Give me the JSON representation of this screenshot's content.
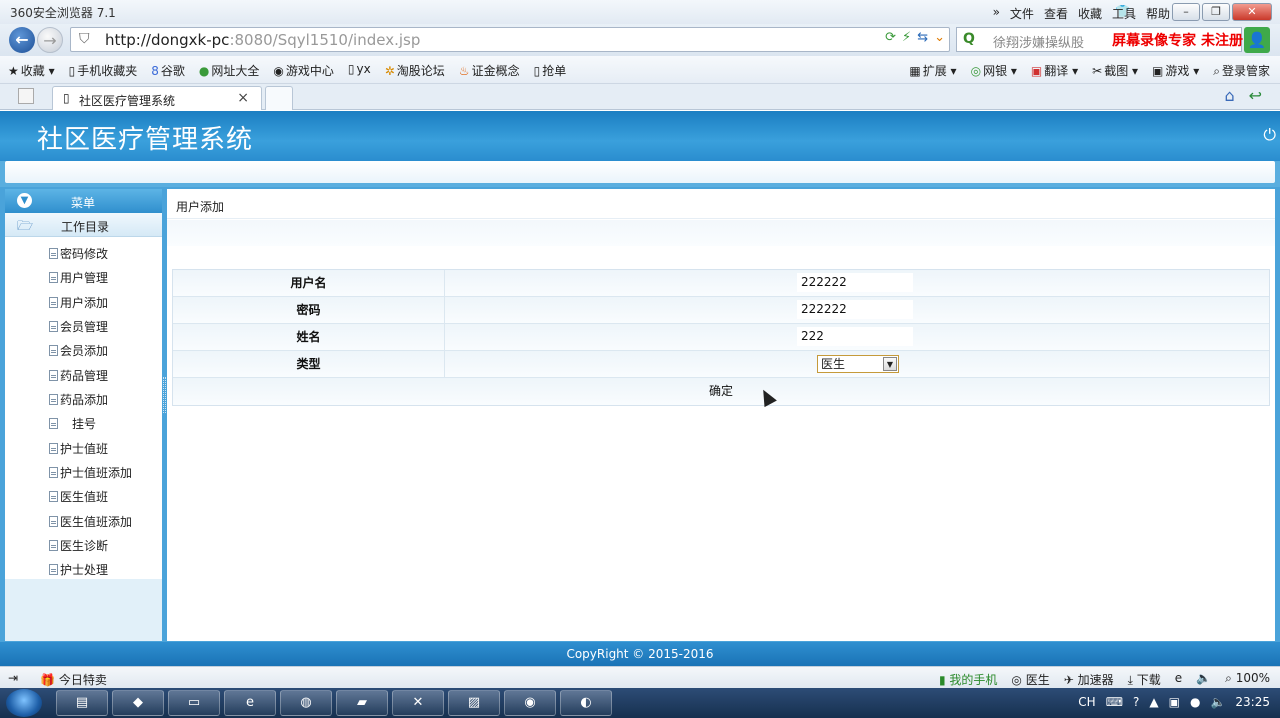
{
  "browser": {
    "title": "360安全浏览器 7.1",
    "menus": [
      "文件",
      "查看",
      "收藏",
      "工具",
      "帮助"
    ],
    "url_host": "http://dongxk-pc",
    "url_rest": ":8080/Sqyl1510/index.jsp",
    "search_hint": "徐翔涉嫌操纵股",
    "recorder_label": "屏幕录像专家 未注册",
    "favorites": [
      "收藏",
      "手机收藏夹",
      "谷歌",
      "网址大全",
      "游戏中心",
      "yx",
      "淘股论坛",
      "证金概念",
      "抢单"
    ],
    "tools": [
      "扩展",
      "网银",
      "翻译",
      "截图",
      "游戏",
      "登录管家"
    ],
    "tab_label": "社区医疗管理系统",
    "tab_close": "×"
  },
  "app": {
    "title": "社区医疗管理系统",
    "footer": "CopyRight © 2015-2016"
  },
  "sidebar": {
    "menu_header": "菜单",
    "group": "工作目录",
    "items": [
      "密码修改",
      "用户管理",
      "用户添加",
      "会员管理",
      "会员添加",
      "药品管理",
      "药品添加",
      "挂号",
      "护士值班",
      "护士值班添加",
      "医生值班",
      "医生值班添加",
      "医生诊断",
      "护士处理"
    ]
  },
  "content": {
    "breadcrumb": "用户添加",
    "form": {
      "username_label": "用户名",
      "username_value": "222222",
      "password_label": "密码",
      "password_value": "222222",
      "name_label": "姓名",
      "name_value": "222",
      "type_label": "类型",
      "type_value": "医生",
      "submit_label": "确定"
    }
  },
  "statusbar": {
    "left": [
      "今日特卖"
    ],
    "right": [
      "我的手机",
      "医生",
      "加速器",
      "下载"
    ],
    "zoom": "100%"
  },
  "taskbar": {
    "lang": "CH",
    "time": "23:25"
  }
}
